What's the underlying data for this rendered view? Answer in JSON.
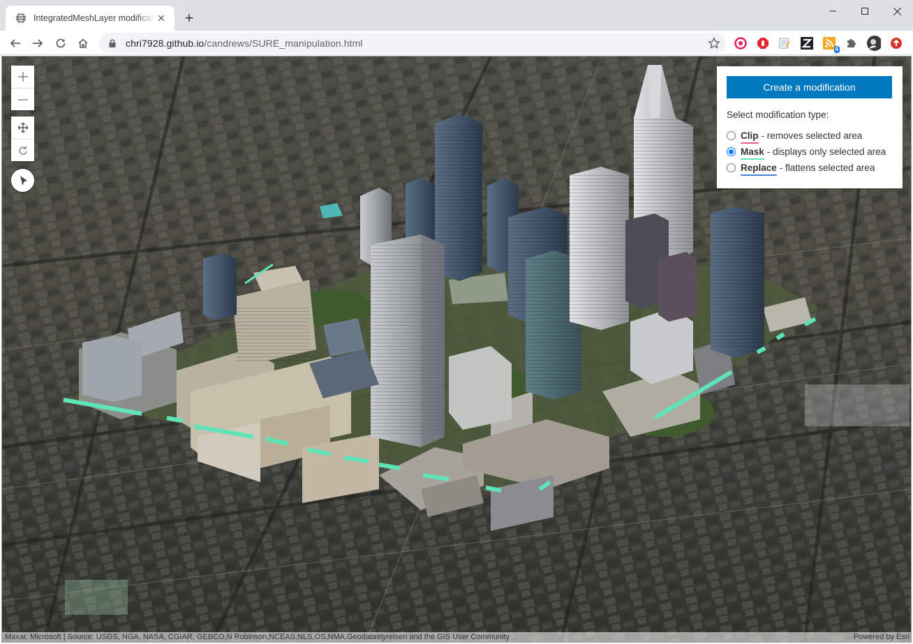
{
  "browser": {
    "tab_title": "IntegratedMeshLayer modification",
    "url_host": "chri7928.github.io",
    "url_path": "/candrews/SURE_manipulation.html",
    "extension_badge": "4"
  },
  "panel": {
    "create_button": "Create a modification",
    "select_label": "Select modification type:",
    "options": [
      {
        "name": "Clip",
        "desc": "- removes selected area",
        "checked": false,
        "underline_color": "#e85d8a"
      },
      {
        "name": "Mask",
        "desc": "- displays only selected area",
        "checked": true,
        "underline_color": "#5fe3b8"
      },
      {
        "name": "Replace",
        "desc": "- flattens selected area",
        "checked": false,
        "underline_color": "#4a7fd6"
      }
    ]
  },
  "map": {
    "attribution_left": "Maxar, Microsoft | Source: USGS, NGA, NASA, CGIAR, GEBCO,N Robinson,NCEAS,NLS,OS,NMA,Geodatastyrelsen and the GIS User Community",
    "attribution_right": "Powered by Esri",
    "mask_color": "#5fe3b8",
    "controls": [
      "zoom-in",
      "zoom-out",
      "pan",
      "rotate",
      "compass"
    ]
  }
}
